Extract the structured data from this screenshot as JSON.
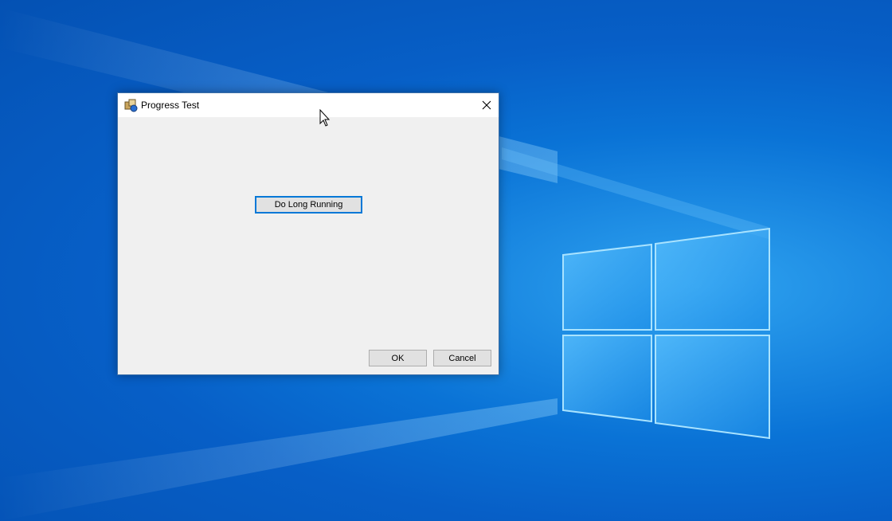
{
  "desktop": {
    "background_color": "#0a73d6",
    "logo": "windows-logo"
  },
  "dialog": {
    "title": "Progress Test",
    "icon": "app-icon",
    "close_icon": "close-icon",
    "long_running_button": "Do Long Running",
    "ok_button": "OK",
    "cancel_button": "Cancel",
    "focus_color": "#0078d7"
  },
  "cursor": "arrow-cursor-icon"
}
